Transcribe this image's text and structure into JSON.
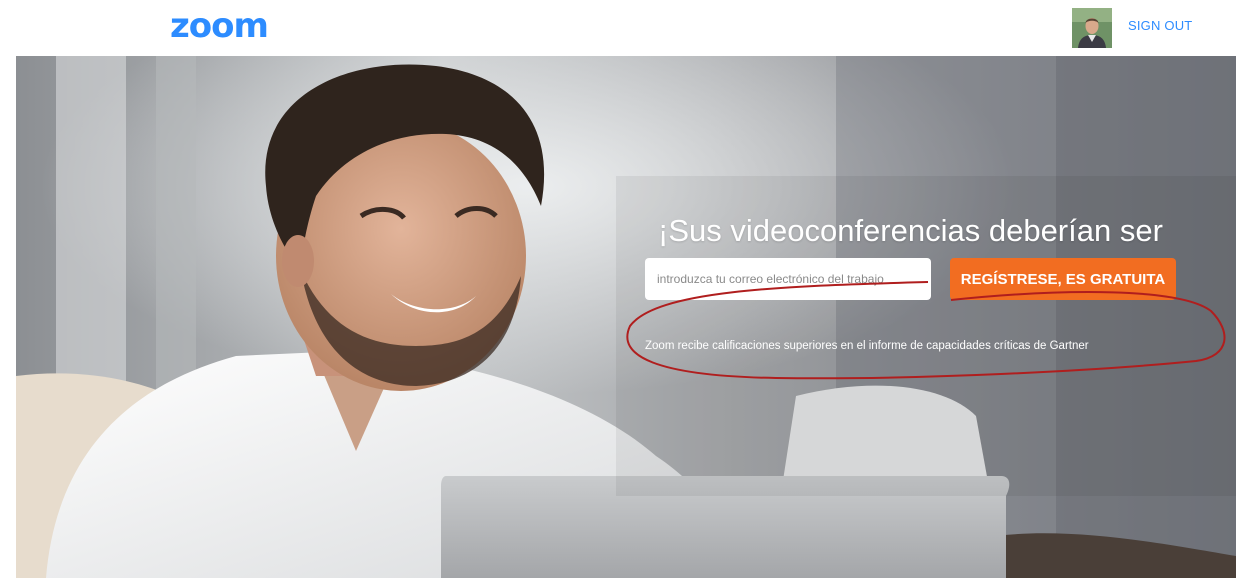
{
  "header": {
    "logo_text": "zoom",
    "signout_label": "SIGN OUT"
  },
  "hero": {
    "headline": "¡Sus videoconferencias deberían ser geniales!",
    "email_placeholder": "introduzca tu correo electrónico del trabajo",
    "signup_label": "REGÍSTRESE, ES GRATUITA",
    "gartner_text": "Zoom recibe calificaciones superiores en el informe de capacidades críticas de Gartner"
  },
  "colors": {
    "brand_blue": "#2d8cff",
    "cta_orange": "#f26d21",
    "annotation_red": "#b01e1e"
  },
  "icons": {
    "avatar": "user-avatar-photo"
  }
}
